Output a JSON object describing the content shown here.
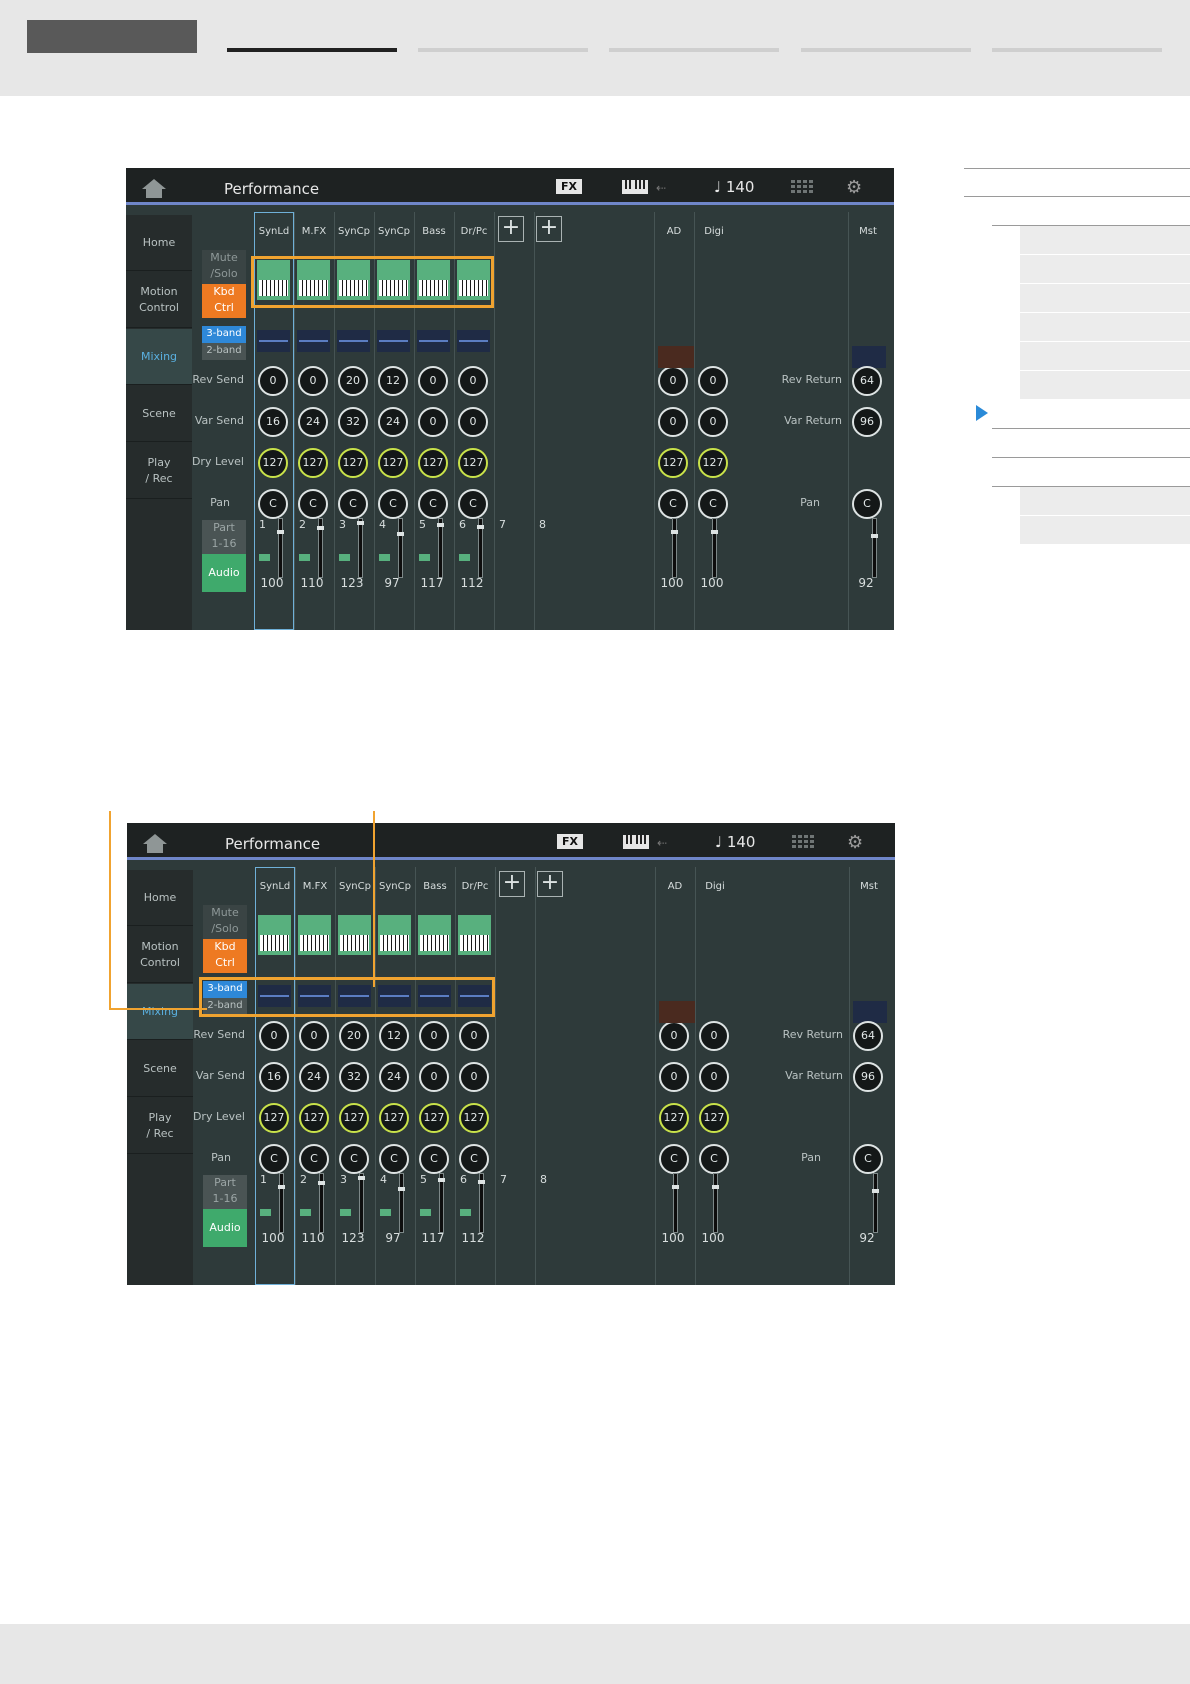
{
  "top_screen": {
    "title": "Performance",
    "fx_label": "FX",
    "tempo": "♩ 140",
    "sidebar_tabs": [
      "Home",
      "Motion\nControl",
      "Mixing",
      "Scene",
      "Play\n/ Rec"
    ],
    "active_tab": "Mixing",
    "mute_solo": "Mute\n/Solo",
    "kbd_ctrl": "Kbd\nCtrl",
    "band3": "3-band",
    "band2": "2-band",
    "part_range": "Part\n1-16",
    "audio": "Audio",
    "row_labels": {
      "rev_send": "Rev Send",
      "var_send": "Var Send",
      "dry_level": "Dry Level",
      "pan": "Pan"
    },
    "parts": [
      {
        "num": "1",
        "name": "SynLd",
        "rev": "0",
        "var": "16",
        "dry": "127",
        "pan": "C",
        "vol": "100"
      },
      {
        "num": "2",
        "name": "M.FX",
        "rev": "0",
        "var": "24",
        "dry": "127",
        "pan": "C",
        "vol": "110"
      },
      {
        "num": "3",
        "name": "SynCp",
        "rev": "20",
        "var": "32",
        "dry": "127",
        "pan": "C",
        "vol": "123"
      },
      {
        "num": "4",
        "name": "SynCp",
        "rev": "12",
        "var": "24",
        "dry": "127",
        "pan": "C",
        "vol": "97"
      },
      {
        "num": "5",
        "name": "Bass",
        "rev": "0",
        "var": "0",
        "dry": "127",
        "pan": "C",
        "vol": "117"
      },
      {
        "num": "6",
        "name": "Dr/Pc",
        "rev": "0",
        "var": "0",
        "dry": "127",
        "pan": "C",
        "vol": "112"
      }
    ],
    "empty_parts": [
      "7",
      "8"
    ],
    "audio_parts": [
      {
        "name": "AD",
        "rev": "0",
        "var": "0",
        "dry": "127",
        "pan": "C",
        "vol": "100"
      },
      {
        "name": "Digi",
        "rev": "0",
        "var": "0",
        "dry": "127",
        "pan": "C",
        "vol": "100"
      }
    ],
    "master": {
      "name": "Mst",
      "rev_return_label": "Rev Return",
      "rev_return": "64",
      "var_return_label": "Var Return",
      "var_return": "96",
      "pan_label": "Pan",
      "pan": "C",
      "vol": "92"
    }
  },
  "colors": {
    "accent_orange": "#f0a330",
    "screen_bg": "#2e3a3a",
    "part_green": "#58b07e",
    "mixing_blue": "#5ab0e0"
  }
}
